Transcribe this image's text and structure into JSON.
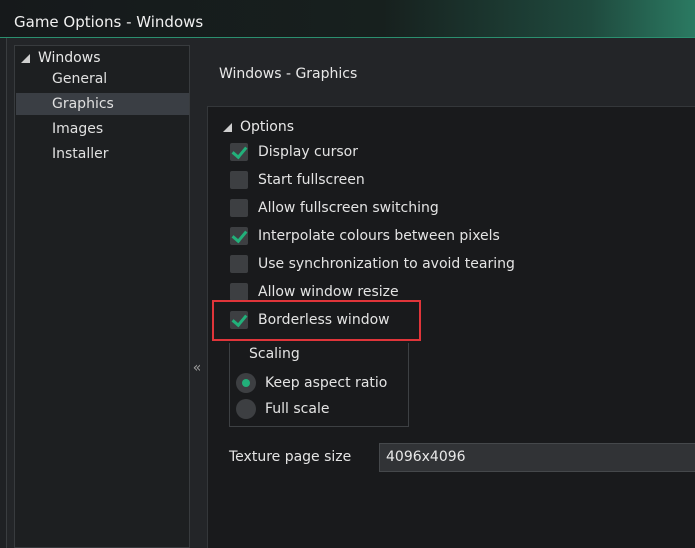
{
  "window": {
    "title": "Game Options - Windows"
  },
  "sidebar": {
    "root": "Windows",
    "items": [
      {
        "label": "General",
        "selected": false
      },
      {
        "label": "Graphics",
        "selected": true
      },
      {
        "label": "Images",
        "selected": false
      },
      {
        "label": "Installer",
        "selected": false
      }
    ],
    "collapse_glyph": "«"
  },
  "main": {
    "heading": "Windows - Graphics",
    "options_header": "Options",
    "checkboxes": [
      {
        "label": "Display cursor",
        "checked": true
      },
      {
        "label": "Start fullscreen",
        "checked": false
      },
      {
        "label": "Allow fullscreen switching",
        "checked": false
      },
      {
        "label": "Interpolate colours between pixels",
        "checked": true
      },
      {
        "label": "Use synchronization to avoid tearing",
        "checked": false
      },
      {
        "label": "Allow window resize",
        "checked": false
      },
      {
        "label": "Borderless window",
        "checked": true
      }
    ],
    "scaling": {
      "label": "Scaling",
      "options": [
        {
          "label": "Keep aspect ratio",
          "selected": true
        },
        {
          "label": "Full scale",
          "selected": false
        }
      ]
    },
    "texture_page": {
      "label": "Texture page size",
      "value": "4096x4096"
    }
  },
  "colors": {
    "accent": "#22b07a",
    "highlight_box": "#e0353a"
  }
}
